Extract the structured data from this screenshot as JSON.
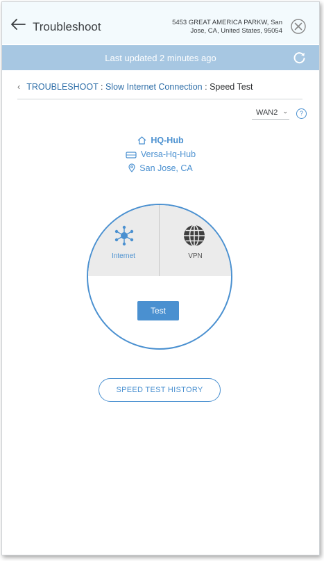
{
  "header": {
    "title": "Troubleshoot",
    "address_line1": "5453 GREAT AMERICA PARKW, San",
    "address_line2": "Jose, CA, United States, 95054"
  },
  "status": {
    "text": "Last updated 2 minutes ago"
  },
  "breadcrumb": {
    "root": "TROUBLESHOOT",
    "separator": ":",
    "issue": "Slow Internet Connection",
    "current": "Speed Test"
  },
  "wan_select": {
    "selected": "WAN2"
  },
  "help": {
    "label": "?"
  },
  "device": {
    "hub": "HQ-Hub",
    "appliance": "Versa-Hq-Hub",
    "location": "San Jose, CA"
  },
  "speed_test": {
    "internet_label": "Internet",
    "vpn_label": "VPN",
    "test_button": "Test"
  },
  "history_button": "SPEED TEST HISTORY",
  "colors": {
    "accent": "#4a90d0",
    "status_bar": "#a7c7e2",
    "header_bg": "#f3fafd",
    "selector_bg": "#ebebeb",
    "vpn_icon": "#3f3f3f"
  },
  "icons": {
    "back": "arrow-left-icon",
    "close": "close-icon",
    "refresh": "refresh-icon",
    "home": "home-icon",
    "appliance": "appliance-icon",
    "location": "map-pin-icon",
    "internet": "network-hub-icon",
    "vpn": "globe-icon"
  }
}
